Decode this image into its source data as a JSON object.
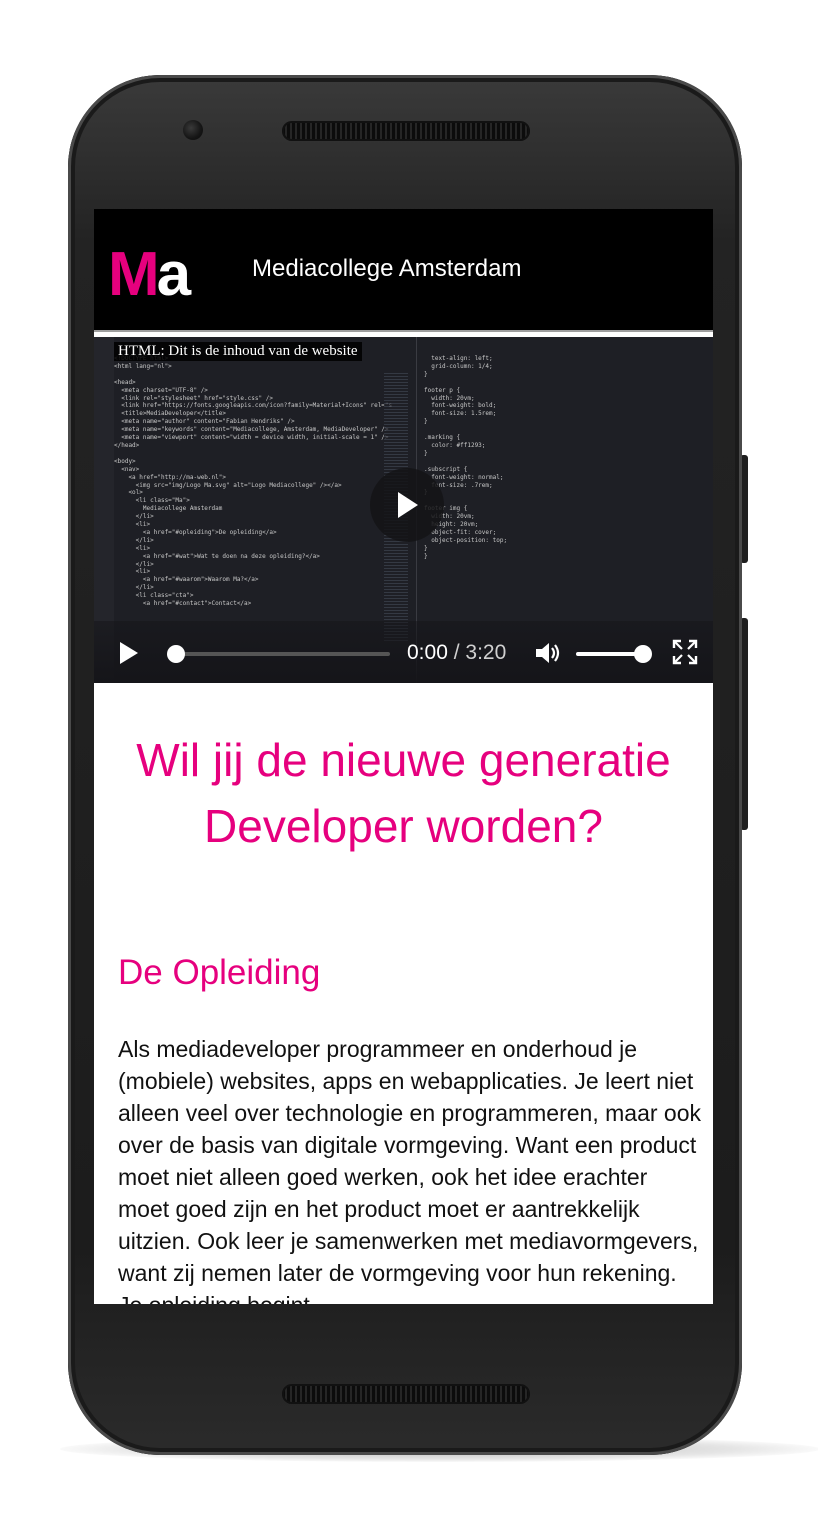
{
  "site": {
    "logo_m": "M",
    "logo_a": "a",
    "title": "Mediacollege Amsterdam"
  },
  "video": {
    "caption": "HTML: Dit is de inhoud van de website",
    "current_time": "0:00",
    "separator": "/",
    "duration": "3:20",
    "progress": 0,
    "volume": 1,
    "code_left": "<!DOCTYPE html>\n<html lang=\"nl\">\n\n<head>\n  <meta charset=\"UTF-8\" />\n  <link rel=\"stylesheet\" href=\"style.css\" />\n  <link href=\"https://fonts.googleapis.com/icon?family=Material+Icons\" rel=\"s\n  <title>MediaDeveloper</title>\n  <meta name=\"author\" content=\"Fabian Hendriks\" />\n  <meta name=\"keywords\" content=\"Mediacollege, Amsterdam, MediaDeveloper\" />\n  <meta name=\"viewport\" content=\"width = device width, initial-scale = 1\" />\n</head>\n\n<body>\n  <nav>\n    <a href=\"http://ma-web.nl\">\n      <img src=\"img/Logo Ma.svg\" alt=\"Logo Mediacollege\" /></a>\n    <ol>\n      <li class=\"Ma\">\n        Mediacollege Amsterdam\n      </li>\n      <li>\n        <a href=\"#opleiding\">De opleiding</a>\n      </li>\n      <li>\n        <a href=\"#wat\">Wat te doen na deze opleiding?</a>\n      </li>\n      <li>\n        <a href=\"#waarom\">Waarom Ma?</a>\n      </li>\n      <li class=\"cta\">\n        <a href=\"#contact\">Contact</a>",
    "code_right": "  text-align: left;\n  grid-column: 1/4;\n}\n\nfooter p {\n  width: 20vm;\n  font-weight: bold;\n  font-size: 1.5rem;\n}\n\n.marking {\n  color: #ff1293;\n}\n\n.subscript {\n  font-weight: normal;\n  font-size: .7rem;\n}\n\nfooter img {\n  width: 20vm;\n  height: 20vm;\n  object-fit: cover;\n  object-position: top;\n}\n}"
  },
  "content": {
    "headline": "Wil jij de nieuwe generatie Developer worden?",
    "section_title": "De Opleiding",
    "paragraph": "Als mediadeveloper programmeer en onderhoud je (mobiele) websites, apps en webapplicaties. Je leert niet alleen veel over technologie en programmeren, maar ook over de basis van digitale vormgeving. Want een product moet niet alleen goed werken, ook het idee erachter moet goed zijn en het product moet er aantrekkelijk uitzien. Ook leer je samenwerken met mediavormgevers, want zij nemen later de vormgeving voor hun rekening. Je opleiding begint"
  },
  "colors": {
    "brand": "#e6007e",
    "header_bg": "#000000",
    "text": "#111111"
  },
  "icons": {
    "play": "play-icon",
    "volume": "volume-icon",
    "fullscreen": "fullscreen-icon"
  }
}
